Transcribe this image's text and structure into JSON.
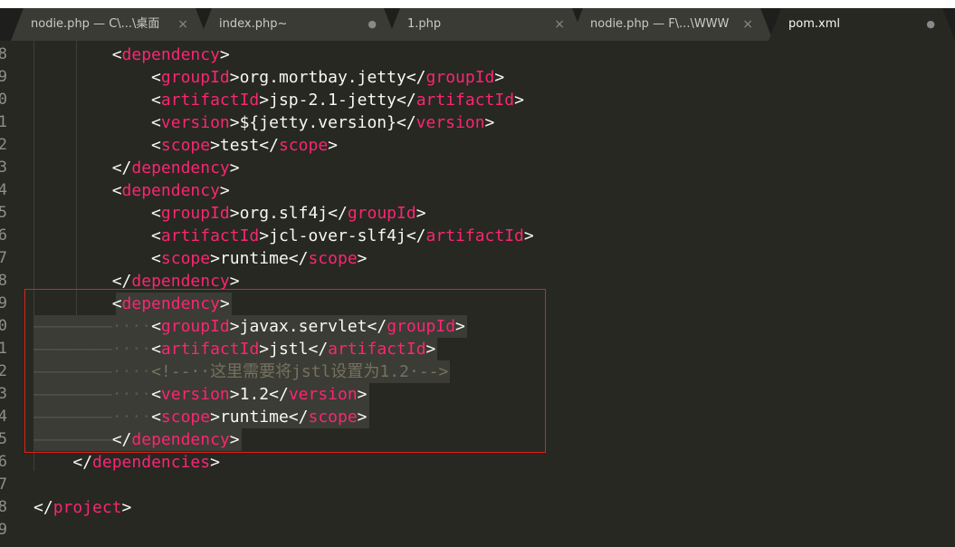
{
  "tabs": [
    {
      "label": "nodie.php — C\\...\\桌面",
      "control": "×",
      "active": false
    },
    {
      "label": "index.php~",
      "control": "●",
      "active": false
    },
    {
      "label": "1.php",
      "control": "×",
      "active": false
    },
    {
      "label": "nodie.php — F\\...\\WWW",
      "control": "×",
      "active": false
    },
    {
      "label": "pom.xml",
      "control": "●",
      "active": true
    }
  ],
  "gutter": {
    "line_numbers": [
      "8",
      "9",
      "0",
      "1",
      "2",
      "3",
      "4",
      "5",
      "6",
      "7",
      "8",
      "9",
      "0",
      "1",
      "2",
      "3",
      "4",
      "5",
      "6",
      "7",
      "8",
      "9"
    ]
  },
  "code": {
    "lines": [
      {
        "ind": "        ",
        "open": "dependency"
      },
      {
        "ind": "            ",
        "open": "groupId",
        "text": "org.mortbay.jetty",
        "close": "groupId"
      },
      {
        "ind": "            ",
        "open": "artifactId",
        "text": "jsp-2.1-jetty",
        "close": "artifactId"
      },
      {
        "ind": "            ",
        "open": "version",
        "text": "${jetty.version}",
        "close": "version"
      },
      {
        "ind": "            ",
        "open": "scope",
        "text": "test",
        "close": "scope"
      },
      {
        "ind": "        ",
        "close": "dependency"
      },
      {
        "ind": "        ",
        "open": "dependency"
      },
      {
        "ind": "            ",
        "open": "groupId",
        "text": "org.slf4j",
        "close": "groupId"
      },
      {
        "ind": "            ",
        "open": "artifactId",
        "text": "jcl-over-slf4j",
        "close": "artifactId"
      },
      {
        "ind": "            ",
        "open": "scope",
        "text": "runtime",
        "close": "scope"
      },
      {
        "ind": "        ",
        "close": "dependency"
      },
      {
        "ind": "        ",
        "open": "dependency",
        "hl": true
      },
      {
        "tabs": "————————",
        "dots": "····",
        "open": "groupId",
        "text": "javax.servlet",
        "close": "groupId",
        "hl": true
      },
      {
        "tabs": "————————",
        "dots": "····",
        "open": "artifactId",
        "text": "jstl",
        "close": "artifactId",
        "hl": true
      },
      {
        "tabs": "————————",
        "dots": "····",
        "comment": "<!--··这里需要将jstl设置为1.2·-->",
        "hl": true
      },
      {
        "tabs": "————————",
        "dots": "····",
        "open": "version",
        "text": "1.2",
        "close": "version",
        "hl": true
      },
      {
        "tabs": "————————",
        "dots": "····",
        "open": "scope",
        "text": "runtime",
        "close": "scope",
        "hl": true
      },
      {
        "tabs": "————————",
        "close": "dependency",
        "hl": true
      },
      {
        "ind": "    ",
        "close": "dependencies"
      },
      {
        "ind": ""
      },
      {
        "ind": "",
        "close": "project"
      },
      {
        "ind": ""
      }
    ]
  },
  "colors": {
    "background": "#272822",
    "tag": "#f92672",
    "punctuation": "#f8f8f2",
    "comment": "#75715e",
    "highlight_box": "#e0201b"
  }
}
